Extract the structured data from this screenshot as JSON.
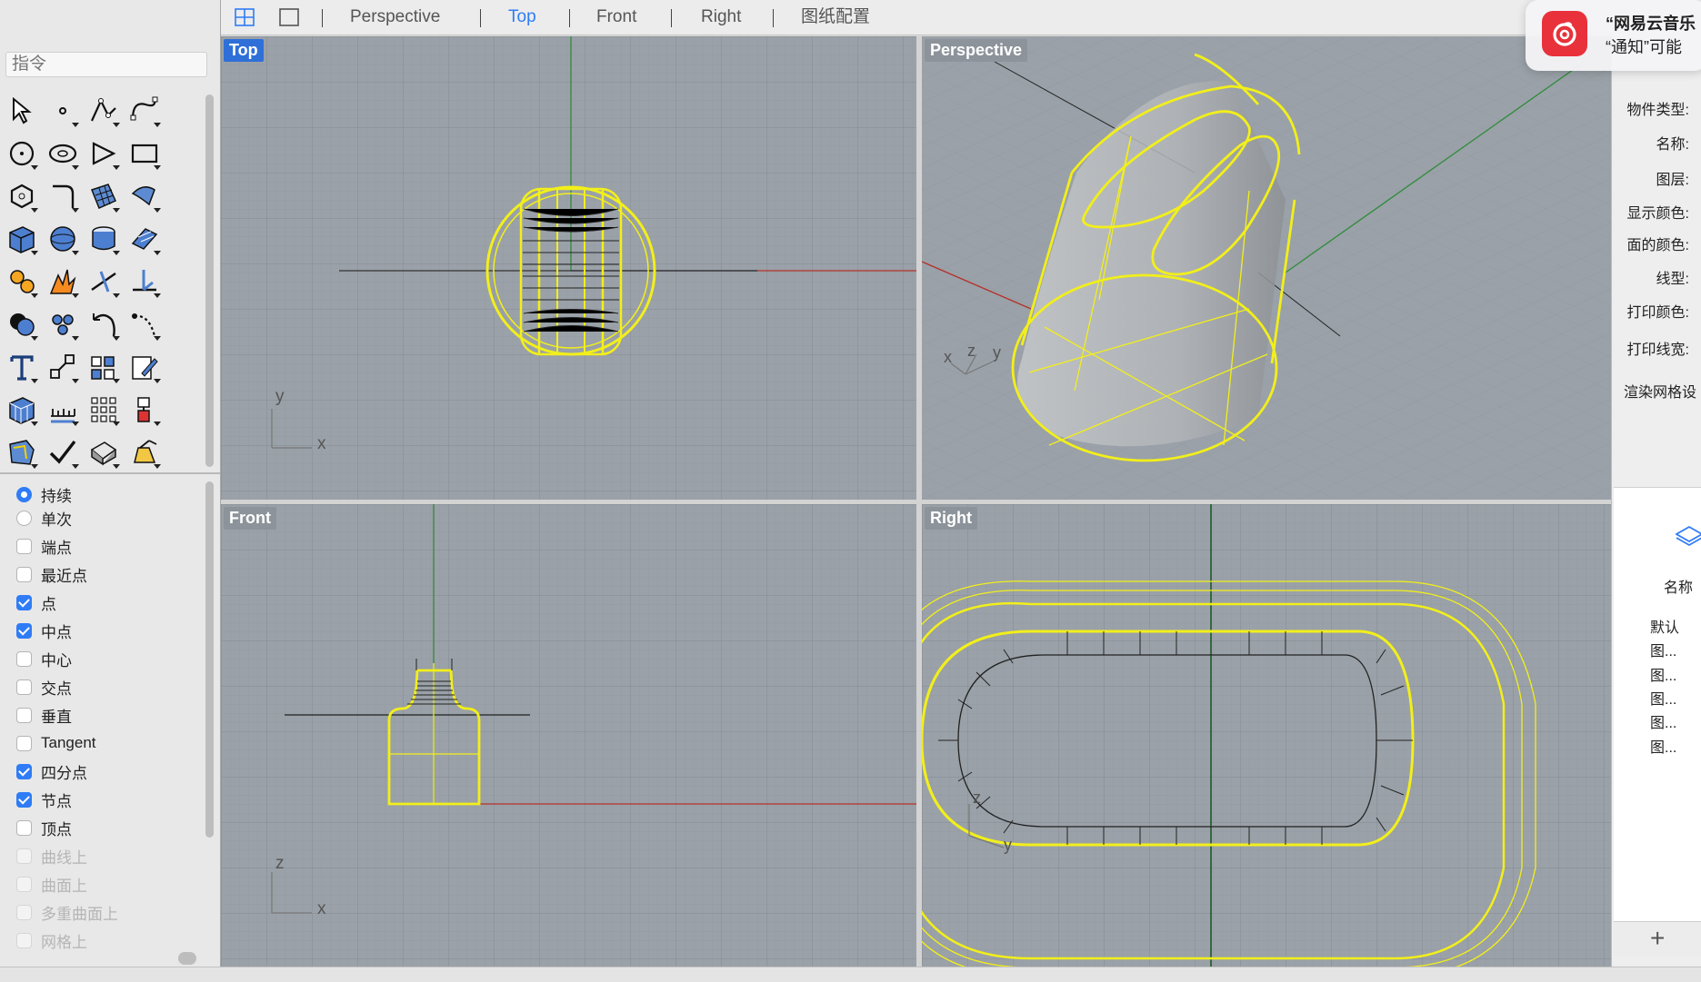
{
  "command": {
    "placeholder": "指令"
  },
  "toolbar": {
    "tools": [
      "select-arrow-icon",
      "point-icon",
      "polyline-icon",
      "curve-icon",
      "circle-icon",
      "ellipse-icon",
      "polygon-icon",
      "rectangle-icon",
      "arc-polygon-icon",
      "fillet-curve-icon",
      "surface-icon",
      "sweep-surface-icon",
      "box-solid-icon",
      "sphere-solid-icon",
      "cylinder-solid-icon",
      "extrude-surface-icon",
      "gear-tools-icon",
      "explode-icon",
      "trim-icon",
      "split-icon",
      "boolean-icon",
      "group-icon",
      "rotate-icon",
      "array-curve-icon",
      "text-icon",
      "scale-icon",
      "align-icon",
      "edit-icon",
      "mesh-box-icon",
      "dimension-icon",
      "grid-array-icon",
      "properties-icon",
      "analyze-icon",
      "check-icon",
      "render-icon",
      "lighting-icon"
    ]
  },
  "osnap": {
    "radios": [
      {
        "label": "持续",
        "checked": true
      },
      {
        "label": "单次",
        "checked": false
      }
    ],
    "items": [
      {
        "label": "端点",
        "checked": false,
        "disabled": false
      },
      {
        "label": "最近点",
        "checked": false,
        "disabled": false
      },
      {
        "label": "点",
        "checked": true,
        "disabled": false
      },
      {
        "label": "中点",
        "checked": true,
        "disabled": false
      },
      {
        "label": "中心",
        "checked": false,
        "disabled": false
      },
      {
        "label": "交点",
        "checked": false,
        "disabled": false
      },
      {
        "label": "垂直",
        "checked": false,
        "disabled": false
      },
      {
        "label": "Tangent",
        "checked": false,
        "disabled": false
      },
      {
        "label": "四分点",
        "checked": true,
        "disabled": false
      },
      {
        "label": "节点",
        "checked": true,
        "disabled": false
      },
      {
        "label": "顶点",
        "checked": false,
        "disabled": false
      },
      {
        "label": "曲线上",
        "checked": false,
        "disabled": true
      },
      {
        "label": "曲面上",
        "checked": false,
        "disabled": true
      },
      {
        "label": "多重曲面上",
        "checked": false,
        "disabled": true
      },
      {
        "label": "网格上",
        "checked": false,
        "disabled": true
      }
    ]
  },
  "tabs": [
    {
      "label": "Perspective",
      "active": false
    },
    {
      "label": "Top",
      "active": true
    },
    {
      "label": "Front",
      "active": false
    },
    {
      "label": "Right",
      "active": false
    },
    {
      "label": "图纸配置",
      "active": false
    }
  ],
  "viewports": {
    "top": {
      "label": "Top",
      "axis_a": "y",
      "axis_b": "x"
    },
    "perspective": {
      "label": "Perspective",
      "axis_x": "x",
      "axis_z": "z",
      "axis_y": "y"
    },
    "front": {
      "label": "Front",
      "axis_a": "z",
      "axis_b": "x"
    },
    "right": {
      "label": "Right",
      "axis_a": "z",
      "axis_b": "y"
    }
  },
  "properties": {
    "labels": [
      "物件类型:",
      "名称:",
      "图层:",
      "显示颜色:",
      "面的颜色:",
      "线型:",
      "打印颜色:",
      "打印线宽:",
      "渲染网格设"
    ]
  },
  "layers": {
    "header": "名称",
    "items": [
      "默认",
      "图...",
      "图...",
      "图...",
      "图...",
      "图..."
    ]
  },
  "notification": {
    "title": "“网易云音乐",
    "body": "“通知”可能"
  },
  "colors": {
    "accent": "#2f7cf6",
    "object_wire": "#f2ef1a",
    "viewport_bg": "#9aa1a8",
    "x_axis": "#b4322a",
    "y_axis": "#2e8b3a"
  }
}
